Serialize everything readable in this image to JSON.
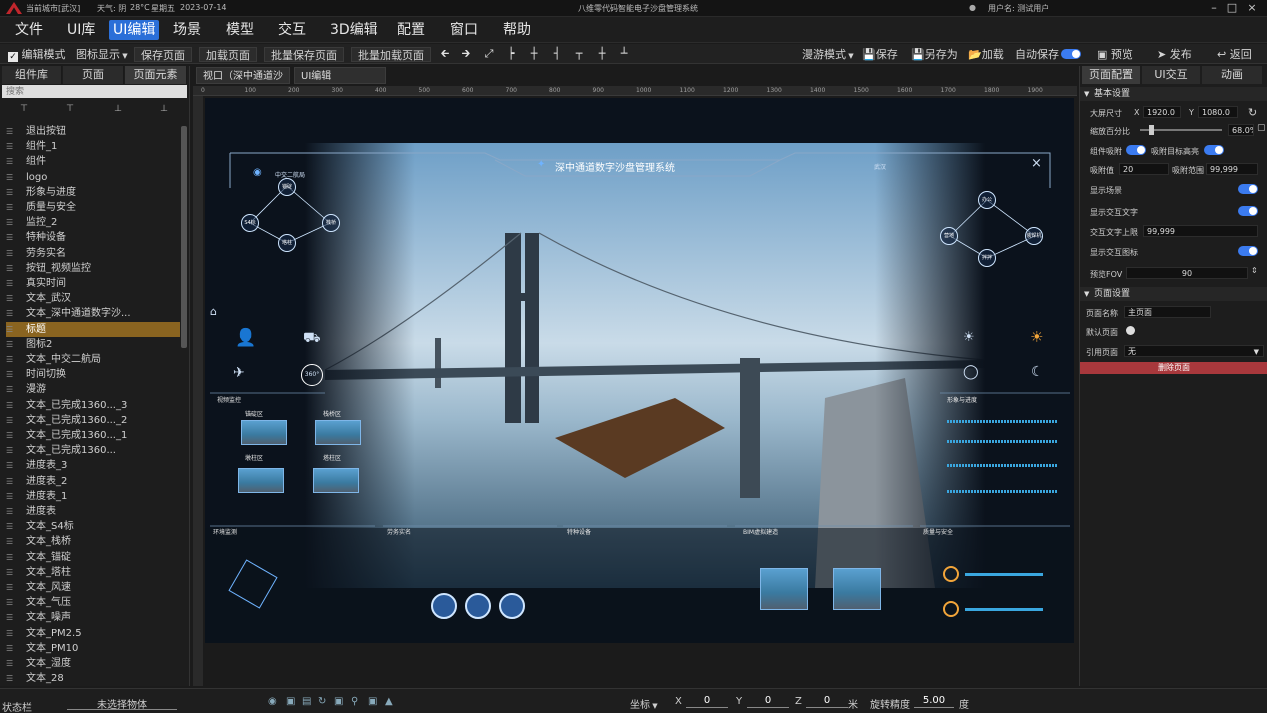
{
  "titlebar": {
    "location": "当前城市[武汉]",
    "weather": "天气: 阴",
    "temperature": "28°C",
    "weekday": "星期五",
    "date": "2023-07-14",
    "app_title": "八维零代码智能电子沙盘管理系统",
    "user": "用户名: 测试用户"
  },
  "menu": [
    "文件",
    "UI库",
    "UI编辑",
    "场景",
    "模型",
    "交互",
    "3D编辑",
    "配置",
    "窗口",
    "帮助"
  ],
  "menu_active": "UI编辑",
  "toolbar": {
    "edit_mode": "编辑模式",
    "icon_display": "图标显示",
    "save_page": "保存页面",
    "load_page": "加载页面",
    "batch_save": "批量保存页面",
    "batch_load": "批量加载页面",
    "roam_mode": "漫游模式",
    "save": "保存",
    "save_as": "另存为",
    "load": "加载",
    "autosave": "自动保存",
    "preview": "预览",
    "publish": "发布",
    "back": "返回"
  },
  "left_panel": {
    "tabs": [
      "组件库",
      "页面",
      "页面元素"
    ],
    "search_placeholder": "搜索",
    "items": [
      "退出按钮",
      "组件_1",
      "组件",
      "logo",
      "形象与进度",
      "质量与安全",
      "监控_2",
      "特种设备",
      "劳务实名",
      "按钮_视频监控",
      "真实时间",
      "文本_武汉",
      "文本_深中通道数字沙...",
      "标题",
      "图标2",
      "文本_中交二航局",
      "时间切换",
      "漫游",
      "文本_已完成1360..._3",
      "文本_已完成1360..._2",
      "文本_已完成1360..._1",
      "文本_已完成1360...",
      "进度表_3",
      "进度表_2",
      "进度表_1",
      "进度表",
      "文本_S4标",
      "文本_栈桥",
      "文本_锚碇",
      "文本_塔柱",
      "文本_风速",
      "文本_气压",
      "文本_噪声",
      "文本_PM2.5",
      "文本_PM10",
      "文本_湿度",
      "文本_28"
    ],
    "selected_index": 13
  },
  "doc_tabs": [
    "视口（深中通道沙",
    "UI编辑"
  ],
  "ruler_marks": [
    "0",
    "100",
    "200",
    "300",
    "400",
    "500",
    "600",
    "700",
    "800",
    "900",
    "1000",
    "1100",
    "1200",
    "1300",
    "1400",
    "1500",
    "1600",
    "1700",
    "1800",
    "1900"
  ],
  "viewport": {
    "title": "深中通道数字沙盘管理系统",
    "org": "中交二航局",
    "city": "武汉",
    "left_nodes": [
      "锚碇",
      "S4标",
      "栈桥",
      "塔柱"
    ],
    "right_nodes": [
      "办公",
      "营地",
      "装焊机",
      "拌拌"
    ],
    "panels": [
      "视频监控",
      "形象与进度",
      "环境监测",
      "劳务实名",
      "特种设备",
      "BIM虚拟建造",
      "质量与安全"
    ],
    "labels": [
      "锚碇区",
      "栈桥区",
      "墩柱区",
      "塔柱区"
    ],
    "time_glyph": "360°"
  },
  "right_panel": {
    "tabs": [
      "页面配置",
      "UI交互",
      "动画"
    ],
    "basic_settings": "基本设置",
    "screen_size_label": "大屏尺寸",
    "x_label": "X",
    "x_value": "1920.0",
    "y_label": "Y",
    "y_value": "1080.0",
    "scale_label": "缩放百分比",
    "scale_value": "68.0%",
    "scale_fraction": 0.68,
    "snap_label": "组件吸附",
    "snap_target_label": "吸附目标高亮",
    "snap_value_label": "吸附值",
    "snap_value": "20",
    "snap_range_label": "吸附范围",
    "snap_range": "99,999",
    "show_scene": "显示场景",
    "show_text": "显示交互文字",
    "text_limit_label": "交互文字上限",
    "text_limit": "99,999",
    "show_icon": "显示交互图标",
    "fov_label": "预览FOV",
    "fov_value": "90",
    "page_settings": "页面设置",
    "page_name_label": "页面名称",
    "page_name": "主页面",
    "default_page_label": "默认页面",
    "ref_page_label": "引用页面",
    "ref_page_value": "无",
    "delete_button": "删除页面"
  },
  "status": {
    "label": "状态栏",
    "selection": "未选择物体",
    "coord_label": "坐标",
    "x_label": "X",
    "x": "0",
    "y_label": "Y",
    "y": "0",
    "z_label": "Z",
    "z": "0",
    "unit": "米",
    "rot_label": "旋转精度",
    "rot": "5.00",
    "rot_unit": "度"
  },
  "colors": {
    "accent": "#2b6fd8",
    "selected": "#8a6420",
    "danger": "#a8383c",
    "toggle": "#3b7bf0"
  }
}
